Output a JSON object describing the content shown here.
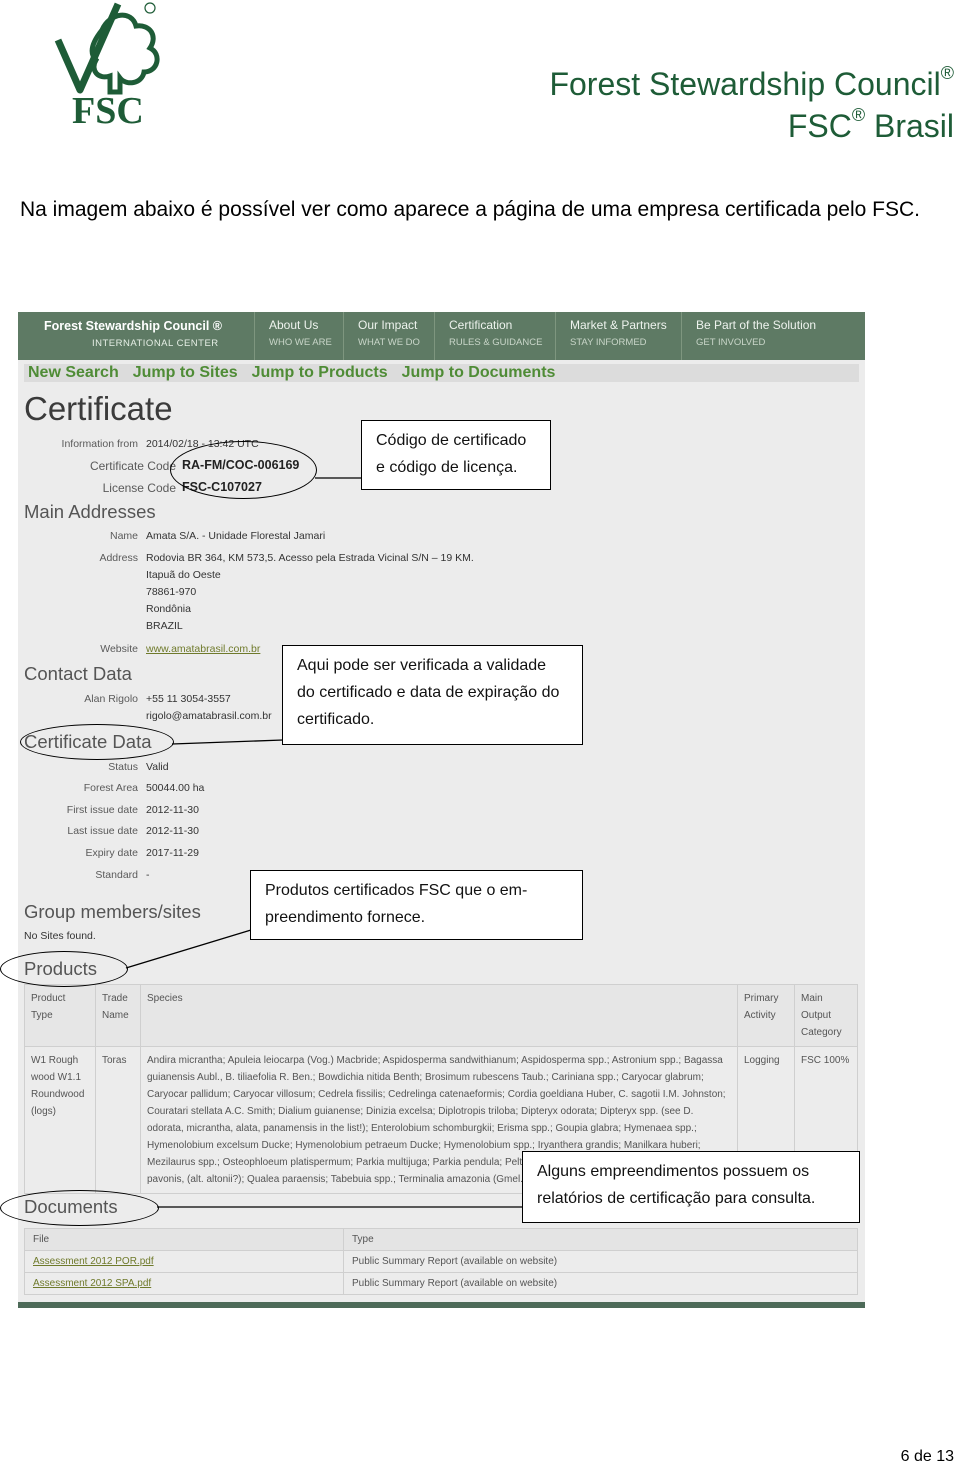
{
  "header": {
    "logo_text": "FSC",
    "org_name": "Forest Stewardship Council",
    "org_sub": "FSC",
    "org_sub_rest": "Brasil",
    "registered": "®"
  },
  "intro": "Na imagem abaixo é possível ver como aparece a página de uma empresa certificada pelo FSC.",
  "screenshot": {
    "nav": {
      "brand": "Forest Stewardship Council ®",
      "brand_sub": "INTERNATIONAL CENTER",
      "items": [
        {
          "label": "About Us",
          "sub": "WHO WE ARE"
        },
        {
          "label": "Our Impact",
          "sub": "WHAT WE DO"
        },
        {
          "label": "Certification",
          "sub": "RULES & GUIDANCE"
        },
        {
          "label": "Market & Partners",
          "sub": "STAY INFORMED"
        },
        {
          "label": "Be Part of the Solution",
          "sub": "GET INVOLVED"
        }
      ]
    },
    "links": [
      "New Search",
      "Jump to Sites",
      "Jump to Products",
      "Jump to Documents"
    ],
    "title": "Certificate",
    "info_from_label": "Information from",
    "info_from_value": "2014/02/18 - 13:42 UTC",
    "cert_code_label": "Certificate Code",
    "cert_code_value": "RA-FM/COC-006169",
    "license_label": "License Code",
    "license_value": "FSC-C107027",
    "main_addresses": "Main Addresses",
    "name_label": "Name",
    "name_value": "Amata S/A. - Unidade Florestal Jamari",
    "address_label": "Address",
    "address_lines": [
      "Rodovia BR 364, KM 573,5. Acesso pela Estrada Vicinal S/N – 19 KM.",
      "Itapuã do Oeste",
      "78861-970",
      "Rondônia",
      "BRAZIL"
    ],
    "website_label": "Website",
    "website_value": "www.amatabrasil.com.br",
    "contact_data": "Contact Data",
    "contact_name": "Alan Rigolo",
    "contact_phone": "+55 11 3054-3557",
    "contact_email": "rigolo@amatabrasil.com.br",
    "certificate_data": "Certificate Data",
    "cert_fields": [
      {
        "label": "Status",
        "value": "Valid"
      },
      {
        "label": "Forest Area",
        "value": "50044.00 ha"
      },
      {
        "label": "First issue date",
        "value": "2012-11-30"
      },
      {
        "label": "Last issue date",
        "value": "2012-11-30"
      },
      {
        "label": "Expiry date",
        "value": "2017-11-29"
      },
      {
        "label": "Standard",
        "value": "-"
      }
    ],
    "group_members": "Group members/sites",
    "no_sites": "No Sites found.",
    "products": "Products",
    "product_headers": [
      "Product Type",
      "Trade Name",
      "Species",
      "Primary Activity",
      "Main Output Category"
    ],
    "product_row": {
      "type": "W1 Rough wood W1.1 Roundwood (logs)",
      "trade": "Toras",
      "species": "Andira micrantha; Apuleia leiocarpa (Vog.) Macbride; Aspidosperma sandwithianum; Aspidosperma spp.; Astronium spp.; Bagassa guianensis Aubl., B. tiliaefolia R. Ben.; Bowdichia nitida Benth; Brosimum rubescens Taub.; Cariniana spp.; Caryocar glabrum; Caryocar pallidum; Caryocar villosum; Cedrela fissilis; Cedrelinga catenaeformis; Cordia goeldiana Huber, C. sagotii I.M. Johnston; Couratari stellata A.C. Smith; Dialium guianense; Dinizia excelsa; Diplotropis triloba; Dipteryx odorata; Dipteryx spp. (see D. odorata, micrantha, alata, panamensis in the list!); Enterolobium schomburgkii; Erisma spp.; Goupia glabra; Hymenaea spp.; Hymenolobium excelsum Ducke; Hymenolobium petraeum Ducke; Hymenolobium spp.; Iryanthera grandis; Manilkara huberi; Mezilaurus spp.; Osteophloeum platispermum; Parkia multijuga; Parkia pendula; Peltogyne paniculata; altissima Ducke, altissimum, pavonis, (alt. altonii?); Qualea paraensis; Tabebuia spp.; Terminalia amazonia (Gmel.) Exell",
      "activity": "Logging",
      "output": "FSC 100%"
    },
    "documents": "Documents",
    "doc_headers": [
      "File",
      "Type"
    ],
    "doc_rows": [
      {
        "file": "Assessment 2012 POR.pdf",
        "type": "Public Summary Report (available on website)"
      },
      {
        "file": "Assessment 2012 SPA.pdf",
        "type": "Public Summary Report (available on website)"
      }
    ]
  },
  "callouts": {
    "codes": "Código de certificado e código de licença.",
    "validity": "Aqui pode ser verificada a validade do certificado e data de expiração do certificado.",
    "products": "Produtos certificados FSC que o em-preendimento fornece.",
    "reports": "Alguns empreendimentos possuem os relatórios de certificação para consulta."
  },
  "page_number": "6 de 13",
  "colors": {
    "brand_green": "#1e5c37",
    "nav_green": "#5e7a64",
    "link_green": "#4f8c36"
  }
}
